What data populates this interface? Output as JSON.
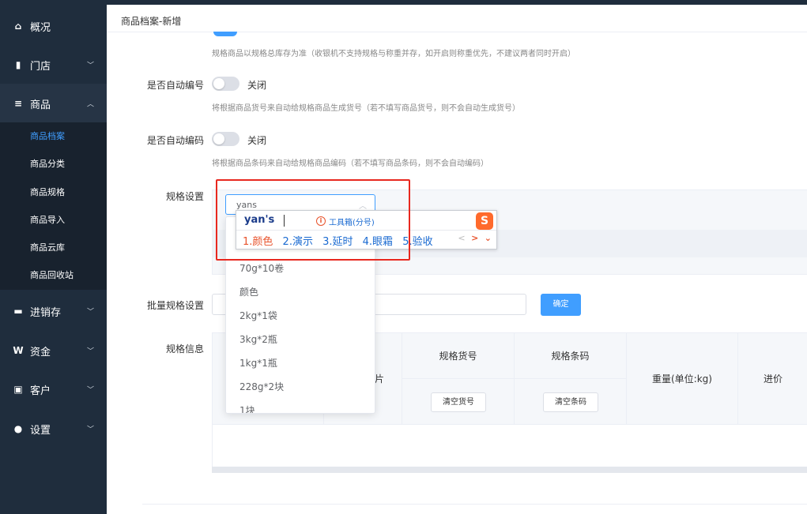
{
  "sidebar": {
    "items": [
      {
        "label": "概况",
        "icon": "home-icon",
        "glyph": "⌂"
      },
      {
        "label": "门店",
        "icon": "store-icon",
        "glyph": "▮"
      },
      {
        "label": "商品",
        "icon": "list-icon",
        "glyph": "≡"
      },
      {
        "label": "进销存",
        "icon": "truck-icon",
        "glyph": "▬"
      },
      {
        "label": "资金",
        "icon": "yen-icon",
        "glyph": "W"
      },
      {
        "label": "客户",
        "icon": "id-card-icon",
        "glyph": "▣"
      },
      {
        "label": "设置",
        "icon": "gear-icon",
        "glyph": "●"
      }
    ],
    "submenu": [
      "商品档案",
      "商品分类",
      "商品规格",
      "商品导入",
      "商品云库",
      "商品回收站"
    ],
    "chevron_down": "﹀",
    "chevron_up": "︿"
  },
  "breadcrumb": "商品档案-新增",
  "form": {
    "hint_top": "规格商品以规格总库存为准（收银机不支持规格与称重并存，如开启则称重优先，不建议两者同时开启）",
    "auto_number": {
      "label": "是否自动编号",
      "state": "关闭",
      "hint": "将根据商品货号来自动给规格商品生成货号（若不填写商品货号，则不会自动生成货号）"
    },
    "auto_code": {
      "label": "是否自动编码",
      "state": "关闭",
      "hint": "将根据商品条码来自动给规格商品编码（若不填写商品条码，则不会自动编码）"
    },
    "spec_label": "规格设置",
    "spec_select_value": "yans",
    "spec_arrow": "︿",
    "spec_options": [
      "70g*10卷",
      "颜色",
      "2kg*1袋",
      "3kg*2瓶",
      "1kg*1瓶",
      "228g*2块",
      "1块"
    ],
    "batch_label": "批量规格设置",
    "confirm_button": "确定",
    "info_label": "规格信息"
  },
  "table": {
    "col_sku": "规格货号",
    "col_barcode": "规格条码",
    "col_weight": "重量(单位:kg)",
    "col_cost": "进价",
    "partial_left": "片",
    "clear_sku_button": "清空货号",
    "clear_barcode_button": "清空条码"
  },
  "ime": {
    "composition": "yan's",
    "tool_icon": "i",
    "toolbox_hint": "工具箱(分号)",
    "logo": "S",
    "candidates": [
      "1.颜色",
      "2.演示",
      "3.延时",
      "4.眼霜",
      "5.验收"
    ],
    "nav_prev": "<",
    "nav_next": ">",
    "nav_expand": "⌄"
  }
}
